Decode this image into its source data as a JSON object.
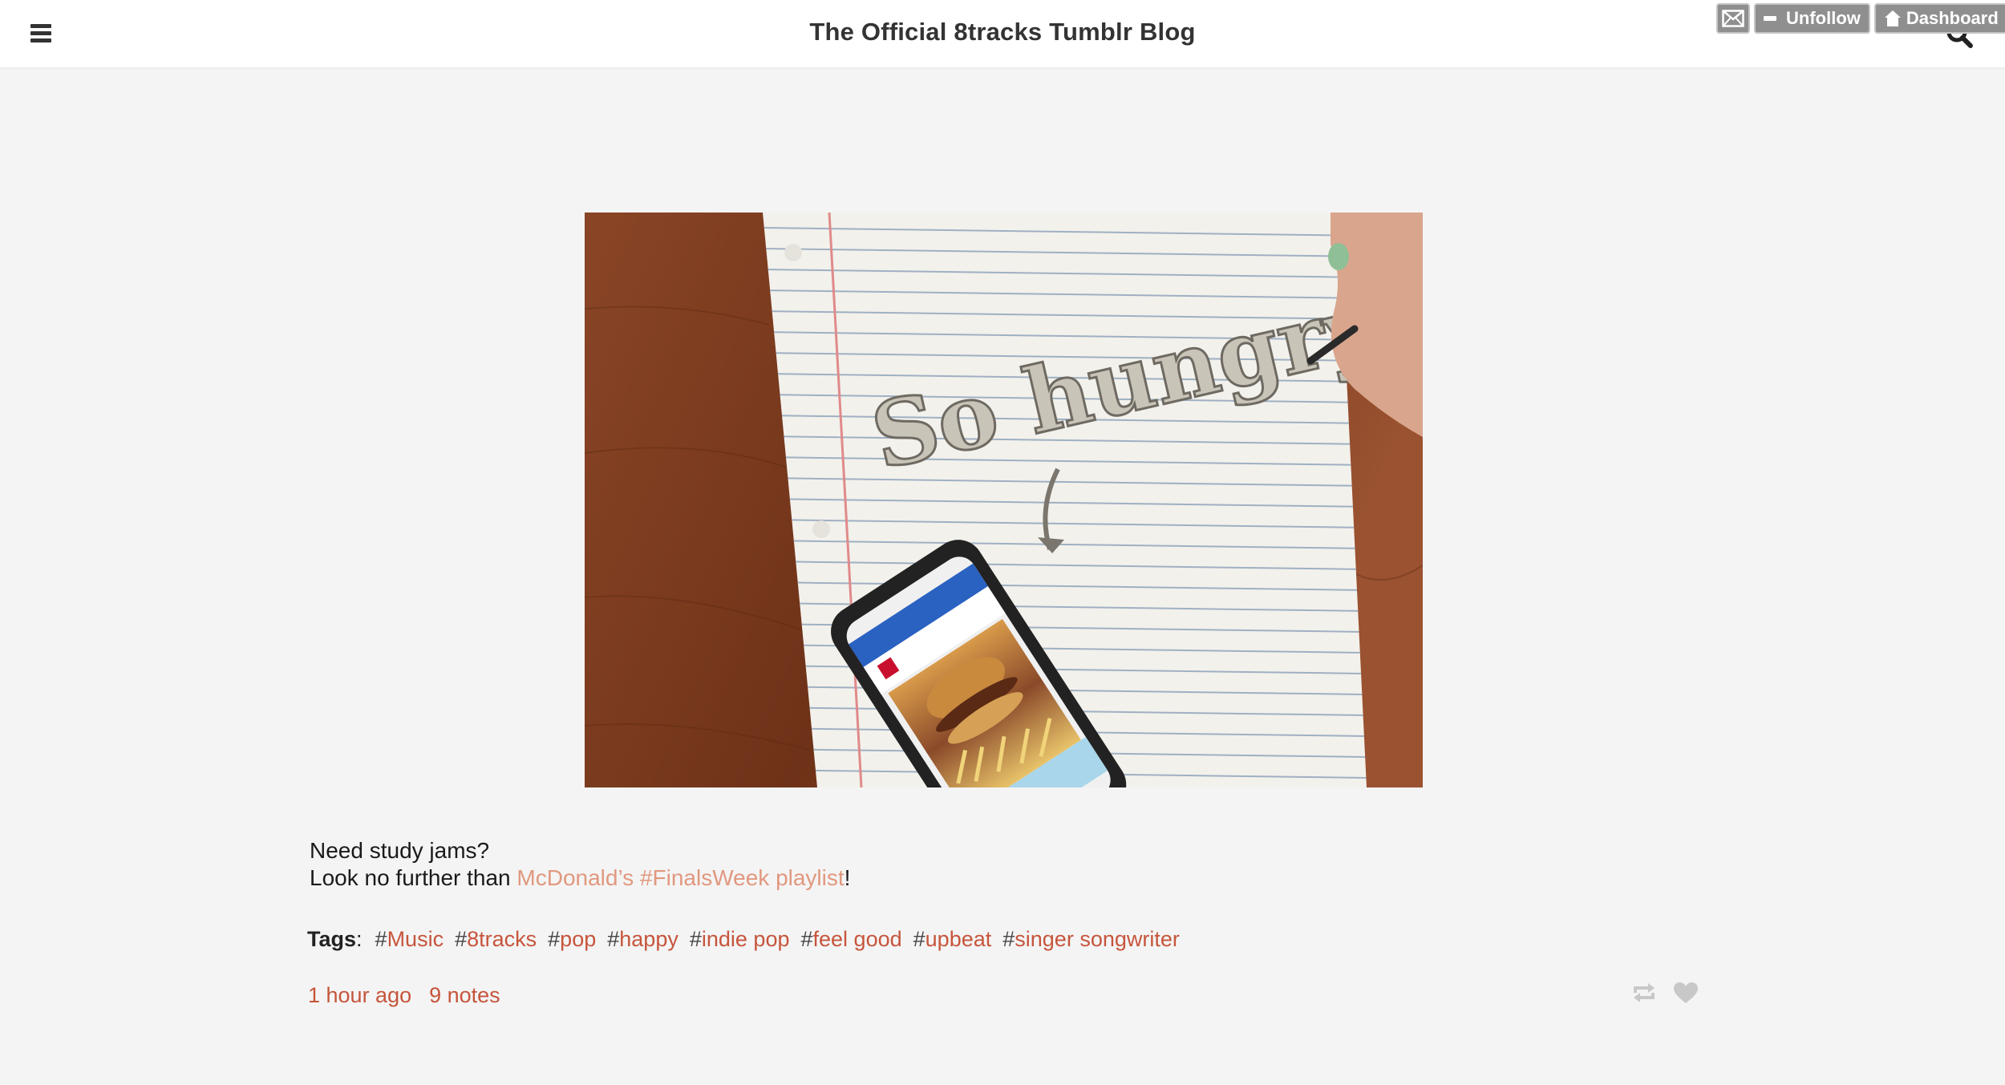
{
  "header": {
    "title": "The Official 8tracks Tumblr Blog"
  },
  "tumblr_controls": {
    "unfollow_label": "Unfollow",
    "dashboard_label": "Dashboard"
  },
  "photo": {
    "handwritten_text": "So hungry"
  },
  "caption": {
    "line1": "Need study jams?",
    "line2_prefix": "Look no further than ",
    "link_text": "McDonald’s #FinalsWeek playlist",
    "line2_suffix": "!"
  },
  "tags": {
    "label": "Tags",
    "colon": ":",
    "items": [
      {
        "hash": "#",
        "text": "Music"
      },
      {
        "hash": "#",
        "text": "8tracks"
      },
      {
        "hash": "#",
        "text": "pop"
      },
      {
        "hash": "#",
        "text": "happy"
      },
      {
        "hash": "#",
        "text": "indie pop"
      },
      {
        "hash": "#",
        "text": "feel good"
      },
      {
        "hash": "#",
        "text": "upbeat"
      },
      {
        "hash": "#",
        "text": "singer songwriter"
      }
    ]
  },
  "meta": {
    "time_ago": "1 hour ago",
    "notes": "9 notes"
  },
  "icons": {
    "menu": "hamburger-menu-icon",
    "search": "search-icon",
    "mail": "mail-icon",
    "unfollow": "minus-icon",
    "dashboard": "home-icon",
    "reblog": "reblog-icon",
    "like": "heart-icon"
  },
  "colors": {
    "background": "#f4f4f4",
    "header_background": "#ffffff",
    "link_accent": "#c6553c",
    "caption_link": "#e1987f",
    "control_button": "#8f8f8f",
    "action_icon": "#c8c8c8"
  }
}
